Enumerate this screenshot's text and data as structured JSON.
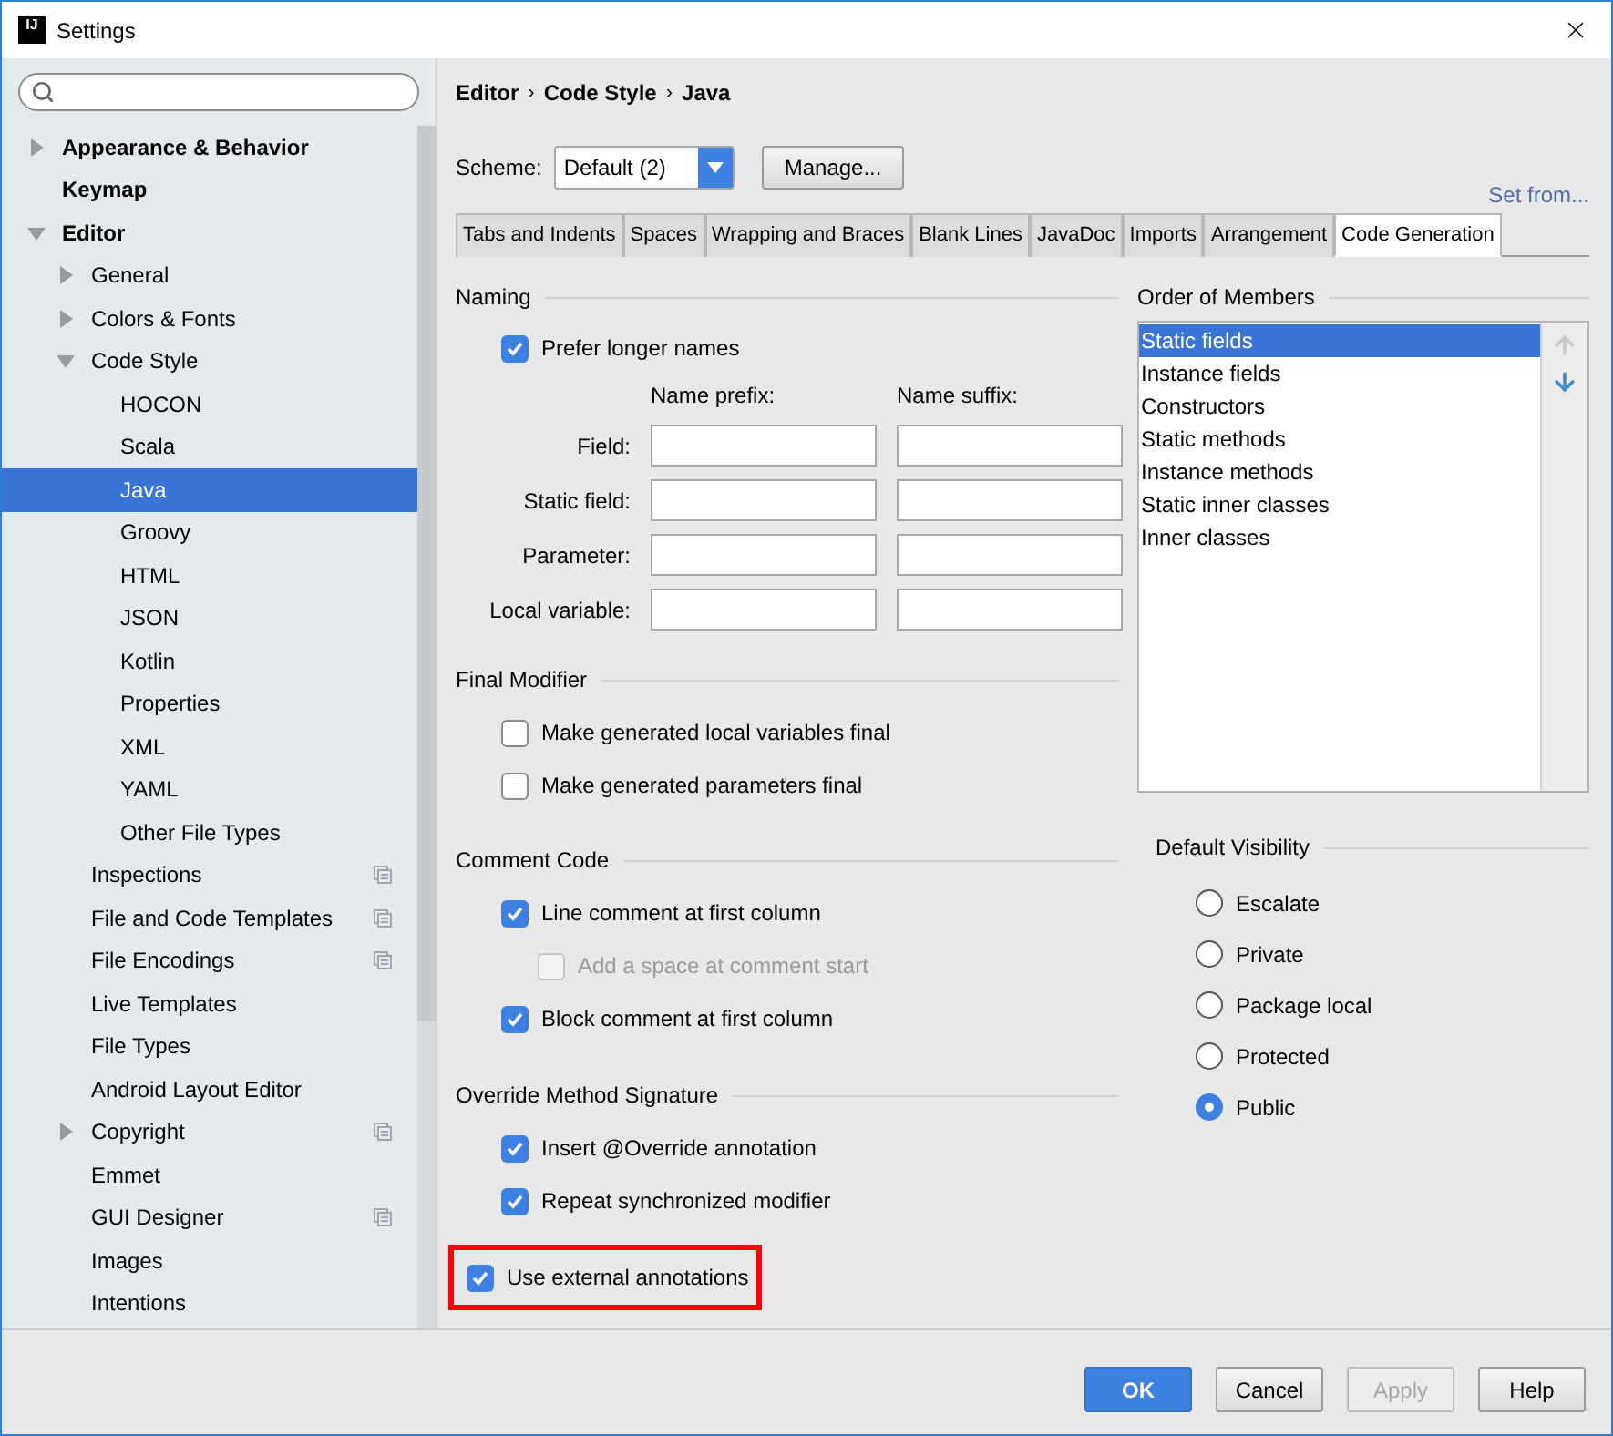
{
  "window": {
    "app_icon": "IJ",
    "title": "Settings"
  },
  "sidebar": {
    "items": [
      {
        "label": "Appearance & Behavior",
        "expanded": false
      },
      {
        "label": "Keymap"
      },
      {
        "label": "Editor",
        "expanded": true,
        "children": [
          {
            "label": "General",
            "expanded": false
          },
          {
            "label": "Colors & Fonts",
            "expanded": false
          },
          {
            "label": "Code Style",
            "expanded": true,
            "children": [
              {
                "label": "HOCON",
                "selected": false
              },
              {
                "label": "Scala",
                "selected": false
              },
              {
                "label": "Java",
                "selected": true
              },
              {
                "label": "Groovy",
                "selected": false
              },
              {
                "label": "HTML",
                "selected": false
              },
              {
                "label": "JSON",
                "selected": false
              },
              {
                "label": "Kotlin",
                "selected": false
              },
              {
                "label": "Properties",
                "selected": false
              },
              {
                "label": "XML",
                "selected": false
              },
              {
                "label": "YAML",
                "selected": false
              },
              {
                "label": "Other File Types",
                "selected": false
              }
            ]
          },
          {
            "label": "Inspections",
            "project_level": true
          },
          {
            "label": "File and Code Templates",
            "project_level": true
          },
          {
            "label": "File Encodings",
            "project_level": true
          },
          {
            "label": "Live Templates"
          },
          {
            "label": "File Types"
          },
          {
            "label": "Android Layout Editor"
          },
          {
            "label": "Copyright",
            "project_level": true,
            "expanded": false
          },
          {
            "label": "Emmet"
          },
          {
            "label": "GUI Designer",
            "project_level": true
          },
          {
            "label": "Images"
          },
          {
            "label": "Intentions"
          }
        ]
      }
    ]
  },
  "breadcrumb": {
    "items": [
      "Editor",
      "Code Style",
      "Java"
    ],
    "separators": [
      "›",
      "›"
    ]
  },
  "scheme": {
    "label": "Scheme:",
    "value": "Default (2)"
  },
  "manage_button": "Manage...",
  "set_from_link": "Set from...",
  "tabs": [
    {
      "label": "Tabs and Indents",
      "selected": false
    },
    {
      "label": "Spaces",
      "selected": false
    },
    {
      "label": "Wrapping and Braces",
      "selected": false
    },
    {
      "label": "Blank Lines",
      "selected": false
    },
    {
      "label": "JavaDoc",
      "selected": false
    },
    {
      "label": "Imports",
      "selected": false
    },
    {
      "label": "Arrangement",
      "selected": false
    },
    {
      "label": "Code Generation",
      "selected": true
    }
  ],
  "naming": {
    "title": "Naming",
    "prefer_longer_names": {
      "label": "Prefer longer names",
      "checked": true
    },
    "column_headers": [
      "Name prefix:",
      "Name suffix:"
    ],
    "rows": [
      {
        "label": "Field:"
      },
      {
        "label": "Static field:"
      },
      {
        "label": "Parameter:"
      },
      {
        "label": "Local variable:"
      }
    ]
  },
  "final_modifier": {
    "title": "Final Modifier",
    "options": [
      {
        "label": "Make generated local variables final",
        "checked": false
      },
      {
        "label": "Make generated parameters final",
        "checked": false
      }
    ]
  },
  "comment_code": {
    "title": "Comment Code",
    "options": [
      {
        "label": "Line comment at first column",
        "checked": true,
        "children": [
          {
            "label": "Add a space at comment start",
            "checked": false,
            "disabled": true
          }
        ]
      },
      {
        "label": "Block comment at first column",
        "checked": true
      }
    ]
  },
  "override_method_signature": {
    "title": "Override Method Signature",
    "options": [
      {
        "label": "Insert @Override annotation",
        "checked": true
      },
      {
        "label": "Repeat synchronized modifier",
        "checked": true
      }
    ]
  },
  "use_external_annotations": {
    "label": "Use external annotations",
    "checked": true,
    "highlighted": true
  },
  "order_of_members": {
    "title": "Order of Members",
    "items": [
      {
        "label": "Static fields",
        "selected": true
      },
      {
        "label": "Instance fields",
        "selected": false
      },
      {
        "label": "Constructors",
        "selected": false
      },
      {
        "label": "Static methods",
        "selected": false
      },
      {
        "label": "Instance methods",
        "selected": false
      },
      {
        "label": "Static inner classes",
        "selected": false
      },
      {
        "label": "Inner classes",
        "selected": false
      }
    ],
    "move_up_disabled": true,
    "move_down_disabled": false
  },
  "default_visibility": {
    "title": "Default Visibility",
    "options": [
      {
        "label": "Escalate",
        "selected": false
      },
      {
        "label": "Private",
        "selected": false
      },
      {
        "label": "Package local",
        "selected": false
      },
      {
        "label": "Protected",
        "selected": false
      },
      {
        "label": "Public",
        "selected": true
      }
    ]
  },
  "buttons": [
    {
      "label": "OK",
      "kind": "primary",
      "disabled": false
    },
    {
      "label": "Cancel",
      "kind": "normal",
      "disabled": false
    },
    {
      "label": "Apply",
      "kind": "normal",
      "disabled": true
    },
    {
      "label": "Help",
      "kind": "normal",
      "disabled": false
    }
  ]
}
